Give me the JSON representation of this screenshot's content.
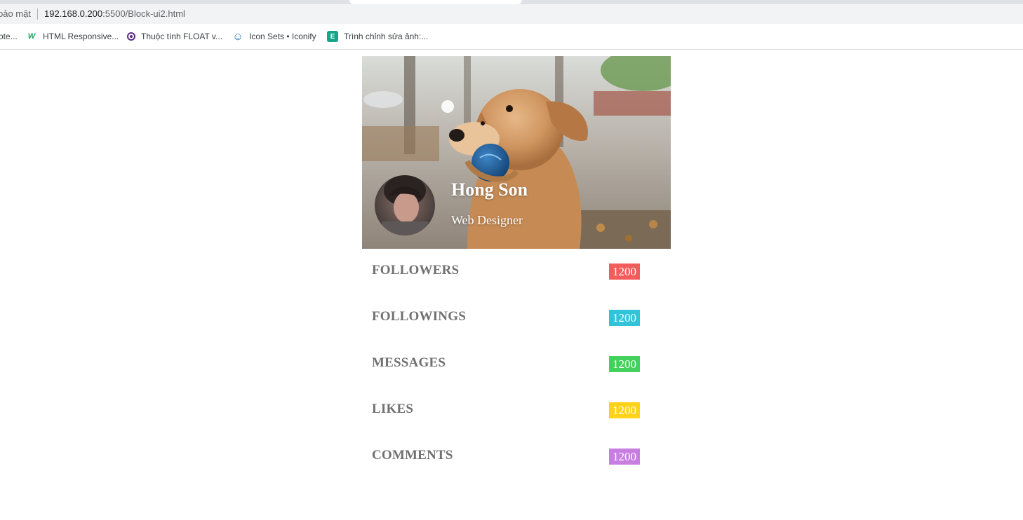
{
  "browser": {
    "security_text": "bảo mật",
    "url_host": "192.168.0.200",
    "url_rest": ":5500/Block-ui2.html",
    "bookmarks": [
      {
        "label": "ote...",
        "icon": "none"
      },
      {
        "label": "HTML Responsive...",
        "icon": "w3-logo-icon"
      },
      {
        "label": "Thuộc tính FLOAT v...",
        "icon": "circle-logo-icon"
      },
      {
        "label": "Icon Sets • Iconify",
        "icon": "smiley-icon"
      },
      {
        "label": "Trình chỉnh sửa ảnh:...",
        "icon": "editor-icon"
      }
    ]
  },
  "profile": {
    "name": "Hong Son",
    "role": "Web Designer"
  },
  "stats": [
    {
      "label": "FOLLOWERS",
      "value": "1200",
      "color": "#f25c5c"
    },
    {
      "label": "FOLLOWINGS",
      "value": "1200",
      "color": "#33c3d9"
    },
    {
      "label": "MESSAGES",
      "value": "1200",
      "color": "#44d05c"
    },
    {
      "label": "LIKES",
      "value": "1200",
      "color": "#ffd21a"
    },
    {
      "label": "COMMENTS",
      "value": "1200",
      "color": "#c77ee0"
    }
  ]
}
